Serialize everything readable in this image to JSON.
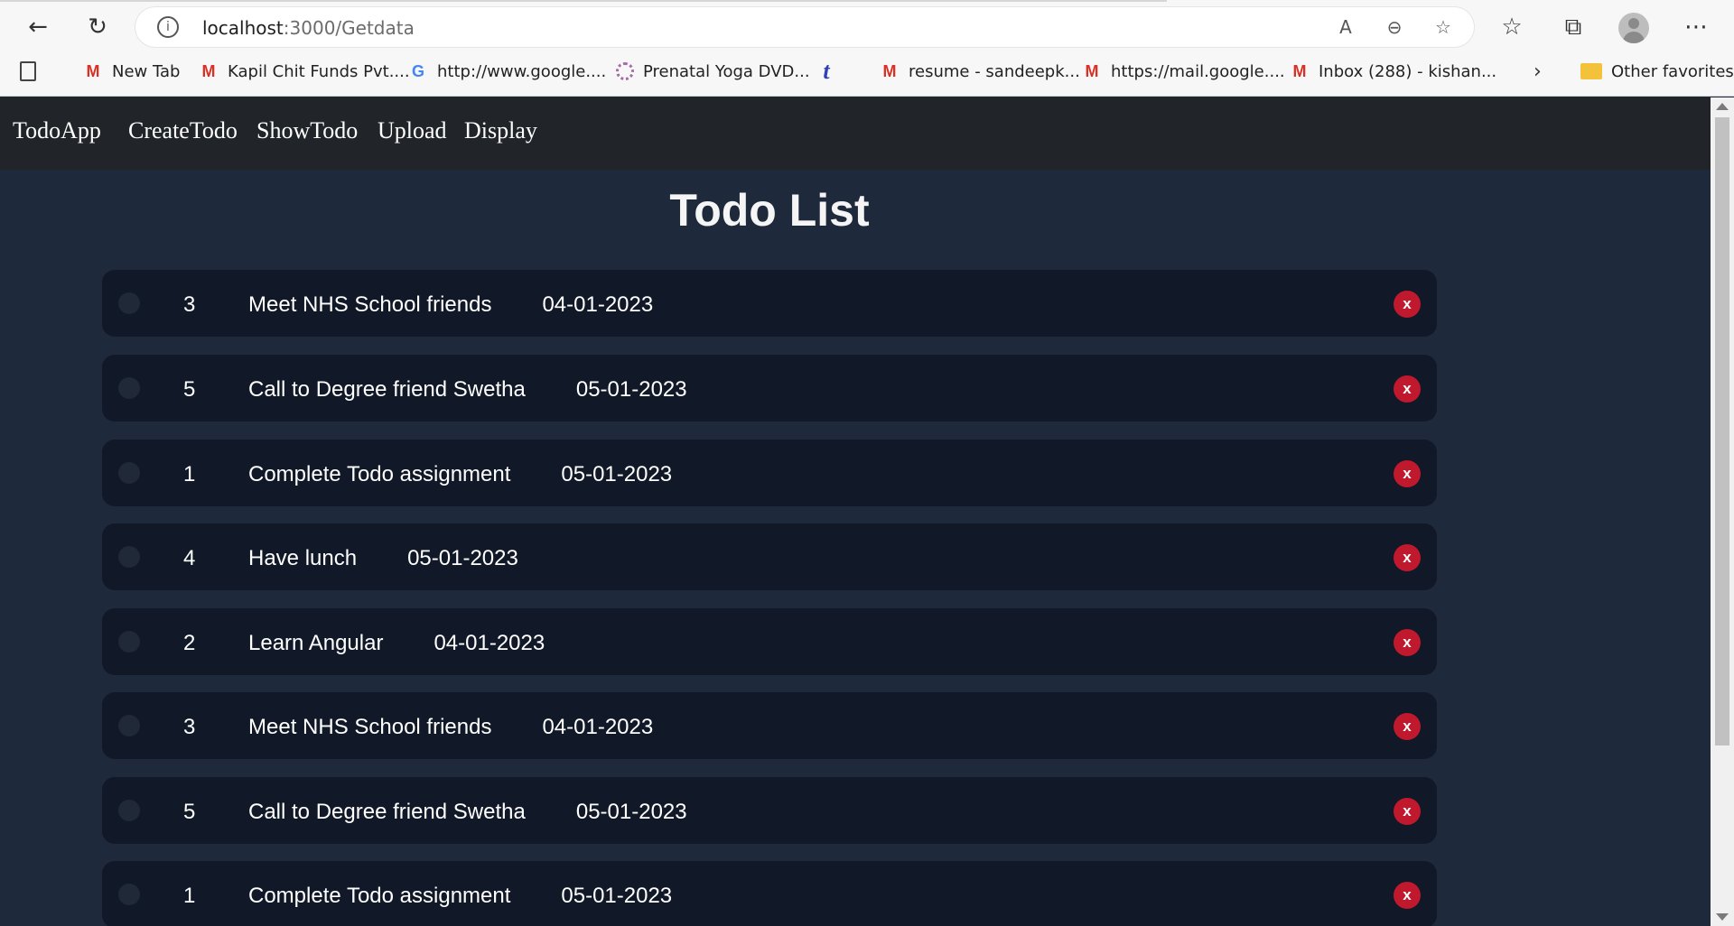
{
  "browser": {
    "url_host": "localhost",
    "url_path": ":3000/Getdata",
    "back_icon": "back-arrow-icon",
    "reload_icon": "reload-icon",
    "bookmarks": [
      {
        "label": "New Tab",
        "icon": "gmail-icon"
      },
      {
        "label": "Kapil Chit Funds Pvt....",
        "icon": "gmail-icon"
      },
      {
        "label": "http://www.google....",
        "icon": "google-icon"
      },
      {
        "label": "Prenatal Yoga DVD...",
        "icon": "yoga-icon"
      },
      {
        "label": "",
        "icon": "tumblr-icon"
      },
      {
        "label": "resume - sandeepk...",
        "icon": "gmail-icon"
      },
      {
        "label": "https://mail.google....",
        "icon": "gmail-icon"
      },
      {
        "label": "Inbox (288) - kishan...",
        "icon": "gmail-icon"
      }
    ],
    "other_favorites": "Other favorites"
  },
  "nav": {
    "brand": "TodoApp",
    "links": [
      "CreateTodo",
      "ShowTodo",
      "Upload",
      "Display"
    ]
  },
  "page": {
    "title": "Todo List"
  },
  "todos": [
    {
      "id": "3",
      "text": "Meet NHS School friends",
      "date": "04-01-2023",
      "delete_label": "x"
    },
    {
      "id": "5",
      "text": "Call to Degree friend Swetha",
      "date": "05-01-2023",
      "delete_label": "x"
    },
    {
      "id": "1",
      "text": "Complete Todo assignment",
      "date": "05-01-2023",
      "delete_label": "x"
    },
    {
      "id": "4",
      "text": "Have lunch",
      "date": "05-01-2023",
      "delete_label": "x"
    },
    {
      "id": "2",
      "text": "Learn Angular",
      "date": "04-01-2023",
      "delete_label": "x"
    },
    {
      "id": "3",
      "text": "Meet NHS School friends",
      "date": "04-01-2023",
      "delete_label": "x"
    },
    {
      "id": "5",
      "text": "Call to Degree friend Swetha",
      "date": "05-01-2023",
      "delete_label": "x"
    },
    {
      "id": "1",
      "text": "Complete Todo assignment",
      "date": "05-01-2023",
      "delete_label": "x"
    }
  ],
  "colors": {
    "navbar_bg": "#212529",
    "page_bg": "#1e293b",
    "card_bg": "#111827",
    "delete_btn": "#c0182d"
  }
}
